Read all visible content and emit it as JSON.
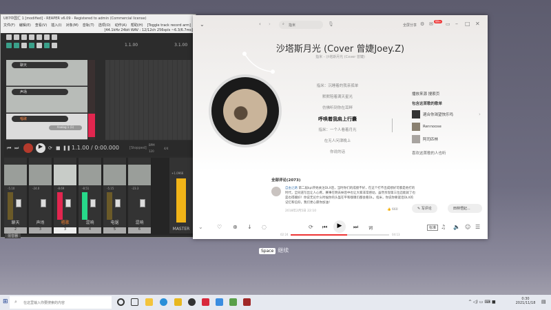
{
  "reaper": {
    "title": "U87中国汇 1 [modified] - REAPER v6.09 - Registered to admin (Commercial license)",
    "menu": [
      "文件(F)",
      "编辑(E)",
      "查看(V)",
      "插入(I)",
      "对象(M)",
      "音轨(T)",
      "选项(O)",
      "动作(A)",
      "帮助(H)",
      "[Toggle track record arm]"
    ],
    "status": "[44.1kHz 24bit WAV : 12/12ch 256spls ~6.3/6.7ms]",
    "ruler": [
      "1.1.00",
      "3.1.00"
    ],
    "tracks": [
      {
        "num": "1",
        "name": "聊天"
      },
      {
        "num": "2",
        "name": "声场"
      },
      {
        "num": "3",
        "name": "唱歌",
        "input": "Analog 1 (1)"
      }
    ],
    "time": "1.1.00 / 0:00.000",
    "state": "[Stopped]",
    "bpm_label": "BPM",
    "bpm": "120",
    "sig": "4/4",
    "mixer": [
      {
        "name": "聊天",
        "num": "2",
        "db": "-5.10"
      },
      {
        "name": "声场",
        "num": "3",
        "db": "-24.0"
      },
      {
        "name": "唱歌",
        "num": "3",
        "db": "-8.69"
      },
      {
        "name": "混响",
        "num": "4",
        "db": "-8.51"
      },
      {
        "name": "电锯",
        "num": "5",
        "db": "-5.15"
      },
      {
        "name": "混响",
        "num": "6",
        "db": "-23.3"
      }
    ],
    "master": "MASTER",
    "master_db": "+1.0966",
    "mixer_tab": "混音器"
  },
  "music": {
    "search": "指米",
    "share": "全屏分享",
    "badge": "99+",
    "title": "沙塔斯月光 (Cover 曾婕Joey.Z)",
    "subtitle": "指米 - 沙塔斯月光 (Cover 曾婕)",
    "lyrics": [
      "指米：沉睡着的我亲孤单",
      "默默陪着满天星光",
      "仿佛听到你在耳畔",
      "呼唤着我肩上行囊",
      "指米：一个人看着月光",
      "在无人问津晚上",
      "你说的话"
    ],
    "current_lyric_index": 3,
    "source": "播放来源  搜索页",
    "playlists_heading": "包含这首歌的歌单",
    "playlists": [
      "適合你渴望快乐吗",
      "Rennoose",
      "阿司匹林"
    ],
    "also_like": "喜欢这首歌的人也听",
    "comments_heading": "全部评论(2073)",
    "comment": {
      "user": "自由之路",
      "text": "第二届kpl开始关注DLX后，当时你们的成绩不好，在这个打不出成绩好可都是他打的时代，全同道写出让人心疼。赛事在明去掉后中也让大家非常感动，虽然亲现第三位迈能就了也是也得输好！你说无论什么时候你的头盔在平和嗅嗅们都会看DL，指米，你说你要诞话DLX的记忆和信仰，我们更心愿你加油！",
      "date": "2018年2月5日 22:10",
      "likes": "660"
    },
    "write_comment": "写评论",
    "listener": "田林悟妃...",
    "elapsed": "02:24",
    "total": "04:13",
    "progress": 0.57,
    "lyric_btn": "词",
    "quality": "标准"
  },
  "hint": {
    "key": "Space",
    "action": "继续"
  },
  "taskbar": {
    "search": "在这里输入你要搜索的内容",
    "time": "0:30",
    "date": "2021/11/18"
  }
}
